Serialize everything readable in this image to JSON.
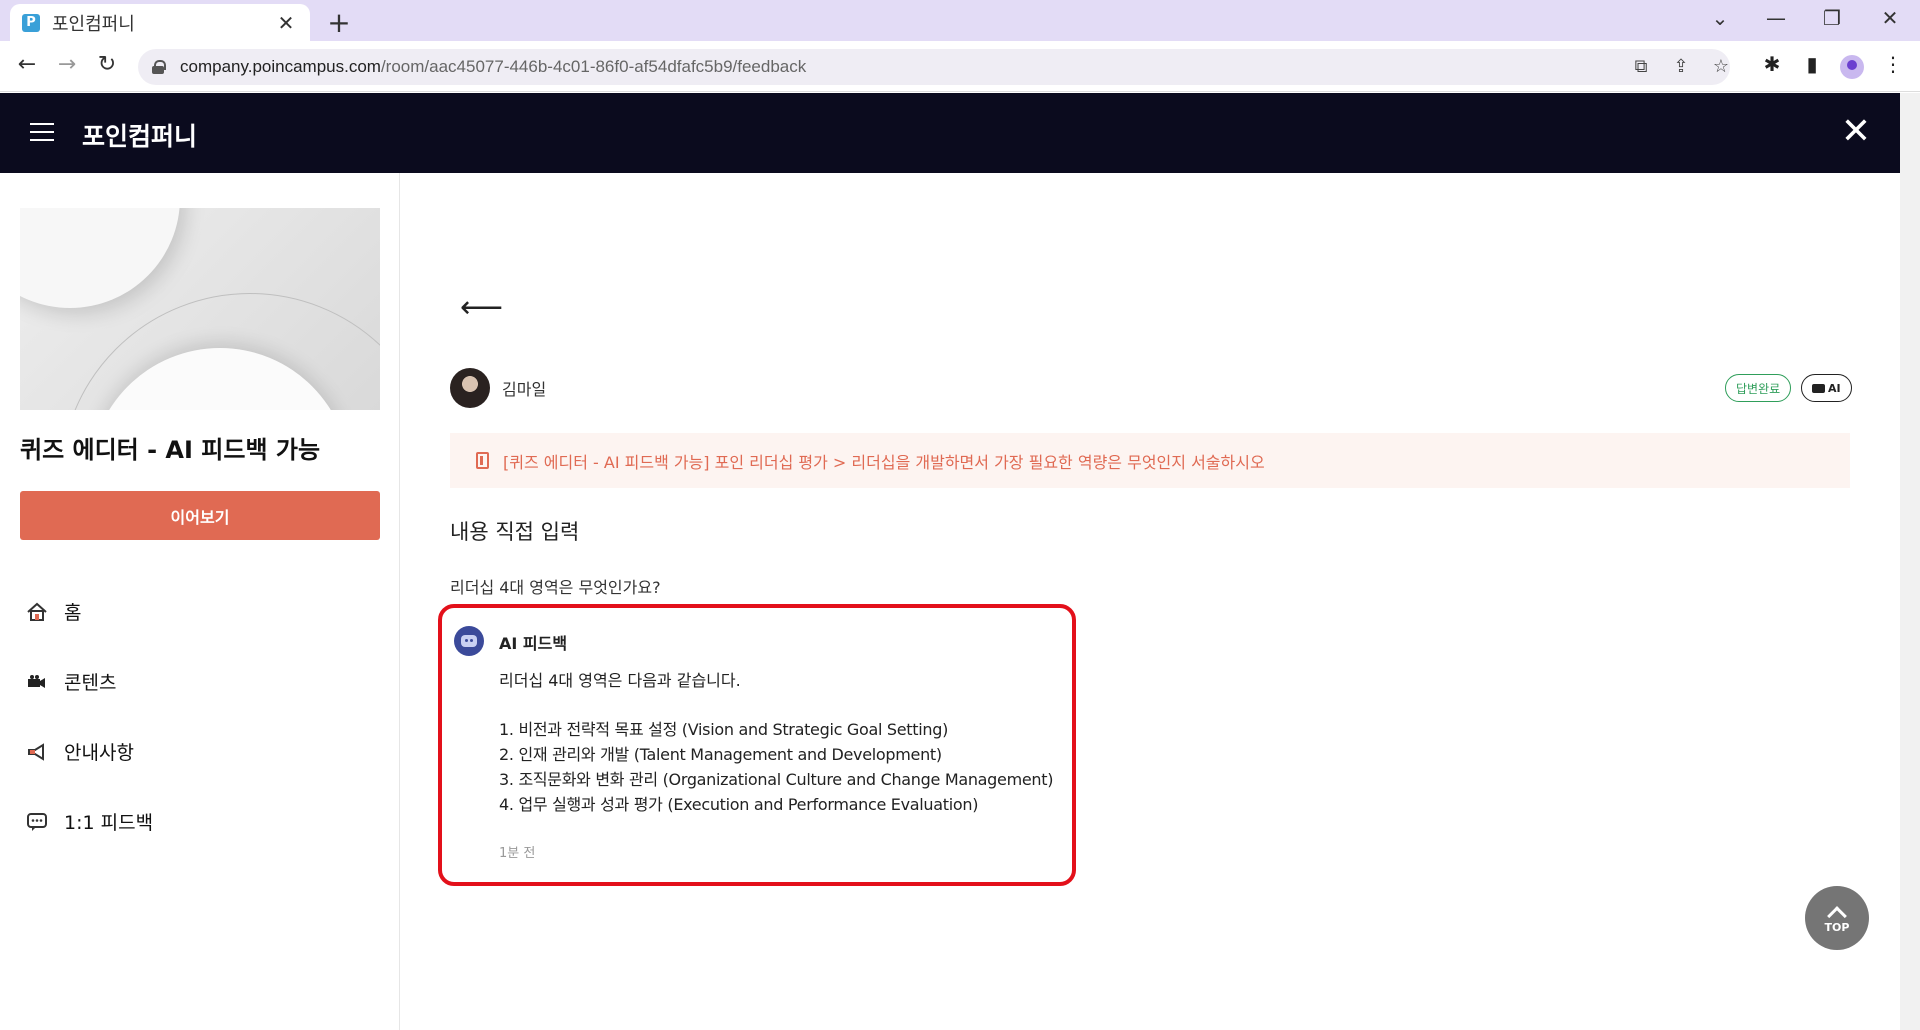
{
  "browser": {
    "tab_title": "포인컴퍼니",
    "favicon_letter": "P",
    "url_host": "company.poincampus.com",
    "url_path": "/room/aac45077-446b-4c01-86f0-af54dfafc5b9/feedback"
  },
  "app": {
    "title": "포인컴퍼니"
  },
  "sidebar": {
    "course_title": "퀴즈 에디터 - AI 피드백 가능",
    "continue_label": "이어보기",
    "items": [
      {
        "label": "홈",
        "icon": "home-icon"
      },
      {
        "label": "콘텐츠",
        "icon": "video-camera-icon"
      },
      {
        "label": "안내사항",
        "icon": "megaphone-icon"
      },
      {
        "label": "1:1 피드백",
        "icon": "chat-bubble-icon"
      }
    ]
  },
  "main": {
    "user_name": "김마일",
    "status_badge": "답변완료",
    "ai_badge": "AI",
    "question": "[퀴즈 에디터 - AI 피드백 가능] 포인 리더십 평가 > 리더십을 개발하면서 가장 필요한 역량은 무엇인지 서술하시오",
    "section_title": "내용 직접 입력",
    "answer": "리더십 4대 영역은 무엇인가요?",
    "feedback": {
      "label": "AI 피드백",
      "intro": "리더십 4대 영역은 다음과 같습니다.",
      "items": [
        "1. 비전과 전략적 목표 설정 (Vision and Strategic Goal Setting)",
        "2. 인재 관리와 개발 (Talent Management and Development)",
        "3. 조직문화와 변화 관리 (Organizational Culture and Change Management)",
        "4. 업무 실행과 성과 평가 (Execution and Performance Evaluation)"
      ],
      "time": "1분 전"
    },
    "top_label": "TOP"
  },
  "colors": {
    "accent": "#e06a53",
    "header_bg": "#0b0b1e",
    "highlight_border": "#e3101a",
    "status_green": "#2f9e5a"
  }
}
